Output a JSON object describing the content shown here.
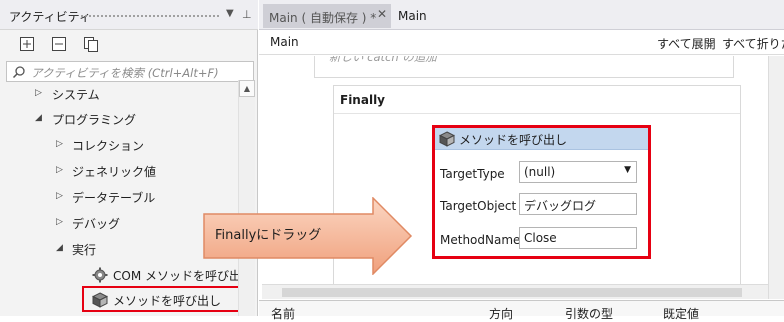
{
  "activities_panel": {
    "title": "アクティビティ",
    "search_placeholder": "アクティビティを検索 (Ctrl+Alt+F)",
    "tree": [
      {
        "label": "システム",
        "expanded": false
      },
      {
        "label": "プログラミング",
        "expanded": true
      },
      {
        "label": "コレクション",
        "expanded": false
      },
      {
        "label": "ジェネリック値",
        "expanded": false
      },
      {
        "label": "データテーブル",
        "expanded": false
      },
      {
        "label": "デバッグ",
        "expanded": false
      },
      {
        "label": "実行",
        "expanded": true
      },
      {
        "label": "COM メソッドを呼び出し"
      },
      {
        "label": "メソッドを呼び出し"
      }
    ]
  },
  "tabs": {
    "active": "Main ( 自動保存 ) *",
    "second": "Main"
  },
  "designer": {
    "breadcrumb": "Main",
    "expand_all": "すべて展開",
    "collapse_all": "すべて折りたた",
    "add_catch": "新しい catch の追加",
    "finally_label": "Finally"
  },
  "invoke_method": {
    "title": "メソッドを呼び出し",
    "target_type_label": "TargetType",
    "target_type_value": "(null)",
    "target_object_label": "TargetObject",
    "target_object_value": "デバッグログ",
    "method_name_label": "MethodName",
    "method_name_value": "Close"
  },
  "callout": {
    "text": "Finallyにドラッグ"
  },
  "args_table": {
    "columns": [
      "名前",
      "方向",
      "引数の型",
      "既定値"
    ]
  },
  "colors": {
    "highlight_red": "#e60012",
    "arrow_fill": "#f4a582",
    "header_blue": "#c3d7ee"
  }
}
